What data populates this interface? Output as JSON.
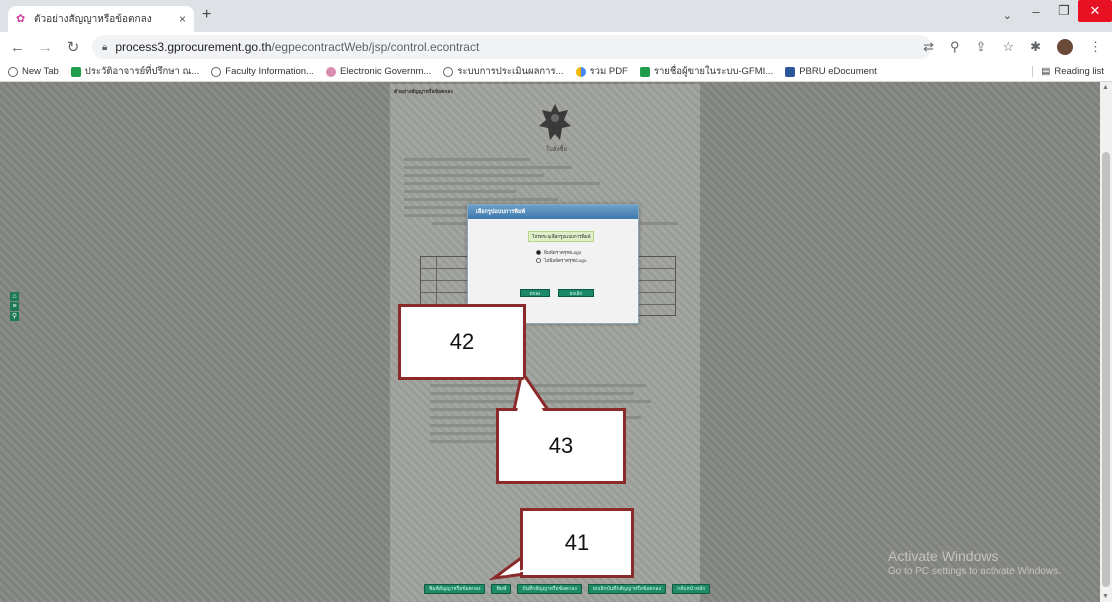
{
  "browser": {
    "tab_title": "ตัวอย่างสัญญาหรือข้อตกลง",
    "tab_close": "×",
    "new_tab": "+",
    "url_host": "process3.gprocurement.go.th",
    "url_path": "/egpecontractWeb/jsp/control.econtract",
    "bookmarks": [
      {
        "label": "New Tab",
        "icon": "globe-icon"
      },
      {
        "label": "ประวัติอาจารย์ที่ปรึกษา ณ...",
        "icon": "green-icon"
      },
      {
        "label": "Faculty Information...",
        "icon": "globe-icon"
      },
      {
        "label": "Electronic Governm...",
        "icon": "pink-icon"
      },
      {
        "label": "ระบบการประเมินผลการ...",
        "icon": "globe-icon"
      },
      {
        "label": "รวม PDF",
        "icon": "multi-icon"
      },
      {
        "label": "รายชื่อผู้ขายในระบบ-GFMI...",
        "icon": "green-icon"
      },
      {
        "label": "PBRU eDocument",
        "icon": "blue-icon"
      }
    ],
    "reading_list": "Reading list"
  },
  "document": {
    "header": "ตัวอย่างสัญญาหรือข้อตกลง",
    "emblem_label": "ใบสั่งซื้อ"
  },
  "dialog": {
    "title": "เลือกรูปแบบการพิมพ์",
    "prompt": "โปรดระบุเลือกรูปแบบการพิมพ์",
    "option1": "พิมพ์ตราครุฑ/Logo",
    "option2": "ไม่พิมพ์ตราครุฑ/Logo",
    "selected": "option1",
    "ok_label": "ตกลง",
    "cancel_label": "ยกเลิก"
  },
  "bottom_buttons": [
    "พิมพ์สัญญาหรือข้อตกลง",
    "พิมพ์",
    "บันทึกสัญญาหรือข้อตกลง",
    "ยกเลิกบันทึกสัญญาหรือข้อตกลง",
    "กลับหน้าหลัก"
  ],
  "callouts": {
    "c41": "41",
    "c42": "42",
    "c43": "43"
  },
  "watermark": {
    "line1": "Activate Windows",
    "line2": "Go to PC settings to activate Windows."
  },
  "colors": {
    "callout_border": "#8b2a2a",
    "button_green": "#1e8a66",
    "dialog_title": "#3d78ac"
  }
}
